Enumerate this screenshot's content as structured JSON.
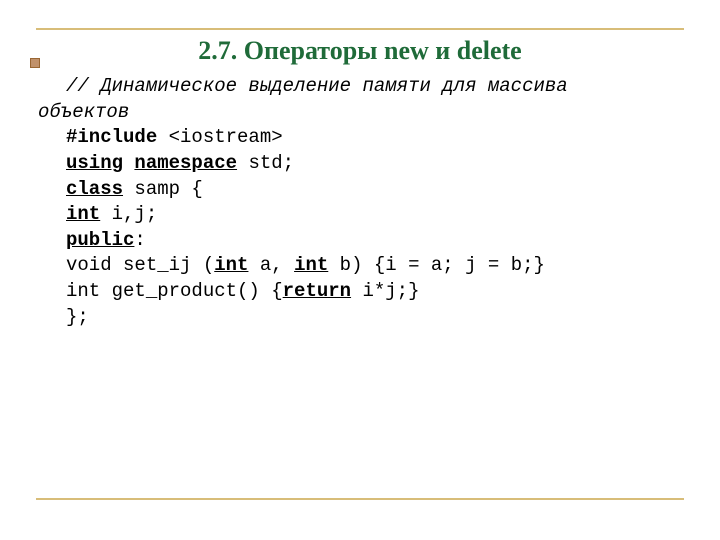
{
  "title": "2.7. Операторы new и delete",
  "code": {
    "comment1_a": "// Динамическое выделение памяти для массива",
    "comment1_b": "объектов",
    "l1_a": "#include",
    "l1_b": " <iostream>",
    "l2_a": "using",
    "l2_b": " ",
    "l2_c": "namespace",
    "l2_d": " std;",
    "l3_a": "class",
    "l3_b": " samp {",
    "l4_a": "int",
    "l4_b": " i,j;",
    "l5_a": "public",
    "l5_b": ":",
    "l6_a": "void set_ij (",
    "l6_b": "int",
    "l6_c": " a, ",
    "l6_d": "int",
    "l6_e": " b) {i = a; j = b;}",
    "l7_a": "int get_product() {",
    "l7_b": "return",
    "l7_c": " i*j;}",
    "l8": "};"
  }
}
